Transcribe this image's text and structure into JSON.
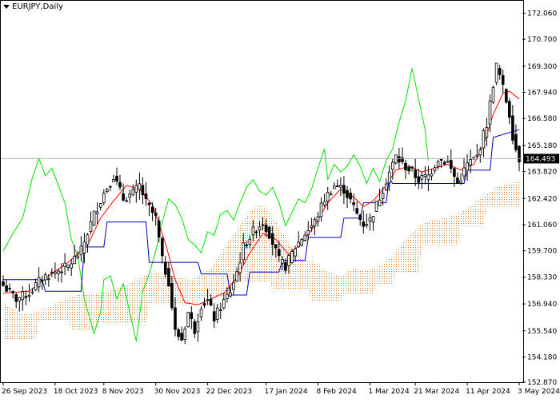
{
  "chart_data": {
    "type": "candlestick",
    "title": "EURJPY,Daily",
    "symbol": "EURJPY",
    "timeframe": "Daily",
    "current_price": "164.493",
    "ylim": [
      152.87,
      172.7
    ],
    "y_ticks": [
      "172.060",
      "170.700",
      "169.300",
      "167.940",
      "166.580",
      "165.180",
      "163.820",
      "162.420",
      "161.060",
      "159.700",
      "158.330",
      "156.940",
      "155.540",
      "154.180",
      "152.870"
    ],
    "x_ticks": [
      "26 Sep 2023",
      "18 Oct 2023",
      "8 Nov 2023",
      "30 Nov 2023",
      "22 Dec 2023",
      "17 Jan 2024",
      "8 Feb 2024",
      "1 Mar 2024",
      "21 Mar 2024",
      "11 Apr 2024",
      "3 May 2024"
    ],
    "x_tick_index": [
      0,
      16,
      31,
      47,
      63,
      81,
      97,
      113,
      127,
      143,
      159
    ],
    "indicator": "Ichimoku Kinko Hyo",
    "series": [
      {
        "name": "Close",
        "color": "#000000",
        "anchors": [
          [
            0,
            157.9
          ],
          [
            4,
            157.2
          ],
          [
            8,
            157.5
          ],
          [
            12,
            158.3
          ],
          [
            16,
            158.6
          ],
          [
            20,
            158.9
          ],
          [
            24,
            159.7
          ],
          [
            28,
            161.6
          ],
          [
            31,
            162.7
          ],
          [
            34,
            163.6
          ],
          [
            37,
            162.4
          ],
          [
            40,
            162.7
          ],
          [
            42,
            163.1
          ],
          [
            44,
            162.2
          ],
          [
            47,
            161.4
          ],
          [
            49,
            159.2
          ],
          [
            51,
            158.1
          ],
          [
            53,
            155.5
          ],
          [
            55,
            155.1
          ],
          [
            57,
            156.5
          ],
          [
            59,
            155.6
          ],
          [
            61,
            156.9
          ],
          [
            63,
            157.1
          ],
          [
            65,
            156.2
          ],
          [
            67,
            156.8
          ],
          [
            70,
            157.6
          ],
          [
            72,
            158.6
          ],
          [
            74,
            159.9
          ],
          [
            77,
            160.7
          ],
          [
            80,
            161.2
          ],
          [
            82,
            160.6
          ],
          [
            85,
            159.2
          ],
          [
            87,
            158.9
          ],
          [
            90,
            159.9
          ],
          [
            93,
            160.6
          ],
          [
            96,
            161.2
          ],
          [
            99,
            162.4
          ],
          [
            102,
            163.1
          ],
          [
            105,
            162.9
          ],
          [
            107,
            162.3
          ],
          [
            109,
            161.6
          ],
          [
            111,
            161.1
          ],
          [
            113,
            161.3
          ],
          [
            116,
            162.5
          ],
          [
            119,
            163.8
          ],
          [
            121,
            164.6
          ],
          [
            123,
            164.2
          ],
          [
            126,
            163.8
          ],
          [
            128,
            163.4
          ],
          [
            131,
            163.6
          ],
          [
            134,
            164.5
          ],
          [
            137,
            164.3
          ],
          [
            140,
            163.2
          ],
          [
            143,
            164.2
          ],
          [
            146,
            164.6
          ],
          [
            149,
            166.3
          ],
          [
            151,
            168.4
          ],
          [
            152,
            169.3
          ],
          [
            153,
            168.8
          ],
          [
            155,
            167.5
          ],
          [
            156,
            166.8
          ],
          [
            157,
            165.7
          ],
          [
            158,
            165.0
          ],
          [
            159,
            164.5
          ]
        ]
      },
      {
        "name": "Tenkan-sen",
        "color": "#ff0000",
        "anchors": [
          [
            0,
            157.5
          ],
          [
            8,
            157.6
          ],
          [
            14,
            158.4
          ],
          [
            20,
            159.1
          ],
          [
            26,
            160.0
          ],
          [
            30,
            161.4
          ],
          [
            34,
            162.3
          ],
          [
            38,
            163.1
          ],
          [
            42,
            162.9
          ],
          [
            46,
            162.1
          ],
          [
            50,
            160.1
          ],
          [
            53,
            158.2
          ],
          [
            56,
            157.0
          ],
          [
            60,
            156.9
          ],
          [
            64,
            157.2
          ],
          [
            68,
            157.5
          ],
          [
            72,
            158.3
          ],
          [
            76,
            159.6
          ],
          [
            80,
            160.6
          ],
          [
            84,
            160.3
          ],
          [
            88,
            159.5
          ],
          [
            92,
            160.1
          ],
          [
            96,
            161.0
          ],
          [
            100,
            162.2
          ],
          [
            104,
            162.9
          ],
          [
            108,
            162.5
          ],
          [
            111,
            162.0
          ],
          [
            114,
            162.3
          ],
          [
            118,
            163.1
          ],
          [
            121,
            163.9
          ],
          [
            125,
            164.1
          ],
          [
            129,
            163.8
          ],
          [
            133,
            164.0
          ],
          [
            137,
            164.2
          ],
          [
            141,
            163.9
          ],
          [
            145,
            164.2
          ],
          [
            148,
            165.2
          ],
          [
            151,
            166.8
          ],
          [
            154,
            167.9
          ],
          [
            156,
            168.0
          ],
          [
            159,
            167.6
          ]
        ]
      },
      {
        "name": "Kijun-sen",
        "color": "#0000bb",
        "anchors": [
          [
            0,
            158.2
          ],
          [
            12,
            158.2
          ],
          [
            13,
            157.6
          ],
          [
            24,
            157.6
          ],
          [
            25,
            159.9
          ],
          [
            31,
            159.9
          ],
          [
            32,
            161.2
          ],
          [
            44,
            161.2
          ],
          [
            45,
            159.1
          ],
          [
            60,
            159.1
          ],
          [
            61,
            158.5
          ],
          [
            69,
            158.5
          ],
          [
            70,
            157.4
          ],
          [
            75,
            157.4
          ],
          [
            76,
            158.6
          ],
          [
            85,
            158.6
          ],
          [
            86,
            159.2
          ],
          [
            93,
            159.2
          ],
          [
            94,
            160.4
          ],
          [
            104,
            160.4
          ],
          [
            105,
            161.4
          ],
          [
            110,
            161.4
          ],
          [
            111,
            162.2
          ],
          [
            118,
            162.2
          ],
          [
            119,
            163.5
          ],
          [
            120,
            163.2
          ],
          [
            142,
            163.2
          ],
          [
            143,
            163.9
          ],
          [
            150,
            163.9
          ],
          [
            151,
            165.6
          ],
          [
            159,
            166.0
          ]
        ]
      },
      {
        "name": "Chikou Span",
        "color": "#00e000",
        "anchors": [
          [
            0,
            159.7
          ],
          [
            3,
            160.6
          ],
          [
            6,
            161.4
          ],
          [
            9,
            163.5
          ],
          [
            11,
            164.5
          ],
          [
            13,
            163.6
          ],
          [
            15,
            164.0
          ],
          [
            17,
            163.1
          ],
          [
            19,
            162.2
          ],
          [
            21,
            160.3
          ],
          [
            23,
            159.4
          ],
          [
            25,
            157.2
          ],
          [
            27,
            156.0
          ],
          [
            28,
            155.4
          ],
          [
            30,
            156.5
          ],
          [
            31,
            158.2
          ],
          [
            33,
            158.4
          ],
          [
            35,
            157.2
          ],
          [
            37,
            158.0
          ],
          [
            39,
            156.5
          ],
          [
            41,
            155.0
          ],
          [
            43,
            157.6
          ],
          [
            45,
            158.5
          ],
          [
            47,
            159.7
          ],
          [
            49,
            161.2
          ],
          [
            51,
            162.4
          ],
          [
            53,
            162.1
          ],
          [
            55,
            161.4
          ],
          [
            57,
            160.3
          ],
          [
            59,
            160.0
          ],
          [
            61,
            159.6
          ],
          [
            63,
            160.7
          ],
          [
            65,
            160.5
          ],
          [
            67,
            161.6
          ],
          [
            69,
            161.8
          ],
          [
            71,
            161.3
          ],
          [
            73,
            162.2
          ],
          [
            75,
            163.0
          ],
          [
            77,
            163.4
          ],
          [
            79,
            162.8
          ],
          [
            81,
            162.6
          ],
          [
            83,
            163.0
          ],
          [
            85,
            162.2
          ],
          [
            87,
            161.0
          ],
          [
            89,
            161.7
          ],
          [
            91,
            162.4
          ],
          [
            93,
            162.2
          ],
          [
            95,
            162.9
          ],
          [
            97,
            164.0
          ],
          [
            99,
            165.0
          ],
          [
            100,
            163.4
          ],
          [
            102,
            164.2
          ],
          [
            104,
            163.8
          ],
          [
            106,
            164.1
          ],
          [
            108,
            164.7
          ],
          [
            110,
            164.1
          ],
          [
            112,
            163.2
          ],
          [
            114,
            164.0
          ],
          [
            116,
            163.3
          ],
          [
            118,
            164.4
          ],
          [
            120,
            165.0
          ],
          [
            122,
            166.4
          ],
          [
            124,
            167.5
          ],
          [
            126,
            169.2
          ],
          [
            128,
            167.6
          ],
          [
            130,
            166.0
          ],
          [
            131,
            164.4
          ]
        ]
      },
      {
        "name": "Senkou Span A",
        "color": "#d9731e",
        "anchors": [
          [
            0,
            157.0
          ],
          [
            6,
            156.4
          ],
          [
            12,
            156.6
          ],
          [
            18,
            157.1
          ],
          [
            24,
            157.5
          ],
          [
            30,
            157.5
          ],
          [
            36,
            157.8
          ],
          [
            40,
            158.1
          ],
          [
            46,
            158.6
          ],
          [
            52,
            158.4
          ],
          [
            58,
            158.2
          ],
          [
            64,
            158.8
          ],
          [
            70,
            160.3
          ],
          [
            76,
            161.8
          ],
          [
            80,
            162.1
          ],
          [
            84,
            161.2
          ],
          [
            88,
            160.1
          ],
          [
            92,
            159.3
          ],
          [
            96,
            159.1
          ],
          [
            100,
            158.6
          ],
          [
            104,
            158.4
          ],
          [
            108,
            158.8
          ],
          [
            112,
            158.7
          ],
          [
            116,
            158.9
          ],
          [
            120,
            159.4
          ],
          [
            124,
            160.3
          ],
          [
            128,
            161.0
          ],
          [
            132,
            161.3
          ],
          [
            136,
            161.4
          ],
          [
            140,
            161.6
          ],
          [
            144,
            162.0
          ],
          [
            148,
            162.5
          ],
          [
            152,
            163.0
          ],
          [
            156,
            163.2
          ],
          [
            159,
            163.3
          ]
        ]
      },
      {
        "name": "Senkou Span B",
        "color": "#d9731e",
        "anchors": [
          [
            0,
            155.1
          ],
          [
            10,
            155.1
          ],
          [
            11,
            156.1
          ],
          [
            20,
            156.1
          ],
          [
            21,
            155.6
          ],
          [
            28,
            155.6
          ],
          [
            29,
            155.9
          ],
          [
            44,
            155.9
          ],
          [
            45,
            157.0
          ],
          [
            60,
            157.0
          ],
          [
            61,
            157.3
          ],
          [
            70,
            157.3
          ],
          [
            71,
            158.1
          ],
          [
            82,
            158.1
          ],
          [
            83,
            157.7
          ],
          [
            94,
            157.7
          ],
          [
            95,
            157.1
          ],
          [
            104,
            157.1
          ],
          [
            105,
            157.4
          ],
          [
            114,
            157.4
          ],
          [
            115,
            158.0
          ],
          [
            120,
            158.0
          ],
          [
            121,
            158.6
          ],
          [
            128,
            158.6
          ],
          [
            129,
            160.0
          ],
          [
            140,
            160.0
          ],
          [
            141,
            161.0
          ],
          [
            148,
            161.0
          ],
          [
            149,
            162.0
          ],
          [
            159,
            162.0
          ]
        ]
      }
    ]
  }
}
